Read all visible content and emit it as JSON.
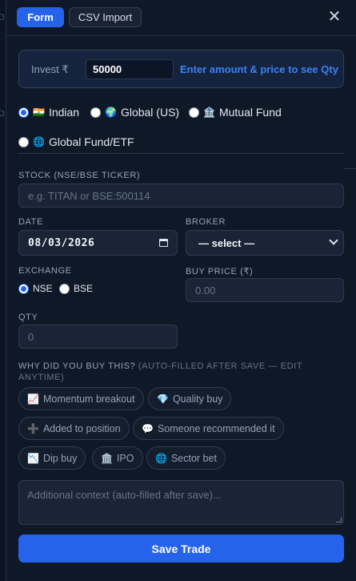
{
  "header": {
    "tabs": [
      {
        "label": "Form",
        "active": true
      },
      {
        "label": "CSV Import",
        "active": false
      }
    ],
    "close_icon": "close-icon",
    "close_glyph": "✕"
  },
  "background": {
    "edge_letters": [
      "D",
      "D"
    ]
  },
  "invest": {
    "label": "Invest ₹",
    "value": "50000",
    "hint": "Enter amount & price to see Qty"
  },
  "market_options": [
    {
      "icon": "🇮🇳",
      "label": "Indian",
      "checked": true
    },
    {
      "icon": "🌍",
      "label": "Global (US)",
      "checked": false
    },
    {
      "icon": "🏦",
      "label": "Mutual Fund",
      "checked": false
    },
    {
      "icon": "🌐",
      "label": "Global Fund/ETF",
      "checked": false
    }
  ],
  "stock": {
    "label": "STOCK (NSE/BSE TICKER)",
    "placeholder": "e.g. TITAN or BSE:500114"
  },
  "date": {
    "label": "DATE",
    "value": "08/03/2026"
  },
  "broker": {
    "label": "BROKER",
    "value": "— select —"
  },
  "exchange": {
    "label": "EXCHANGE",
    "options": [
      {
        "label": "NSE",
        "checked": true
      },
      {
        "label": "BSE",
        "checked": false
      }
    ]
  },
  "buy_price": {
    "label": "BUY PRICE (₹)",
    "placeholder": "0.00"
  },
  "qty": {
    "label": "QTY",
    "placeholder": "0"
  },
  "reason": {
    "label": "WHY DID YOU BUY THIS?",
    "label_suffix": "(AUTO-FILLED AFTER SAVE — EDIT ANYTIME)",
    "chips": [
      {
        "icon": "📈",
        "label": "Momentum breakout"
      },
      {
        "icon": "💎",
        "label": "Quality buy"
      },
      {
        "icon": "➕",
        "label": "Added to position"
      },
      {
        "icon": "💬",
        "label": "Someone recommended it"
      },
      {
        "icon": "📉",
        "label": "Dip buy"
      },
      {
        "icon": "🏛️",
        "label": "IPO"
      },
      {
        "icon": "🌐",
        "label": "Sector bet"
      }
    ]
  },
  "context": {
    "placeholder": "Additional context (auto-filled after save)..."
  },
  "save_label": "Save Trade",
  "colors": {
    "accent": "#2563eb",
    "hint": "#3b82f6",
    "panel": "#0f1827"
  }
}
